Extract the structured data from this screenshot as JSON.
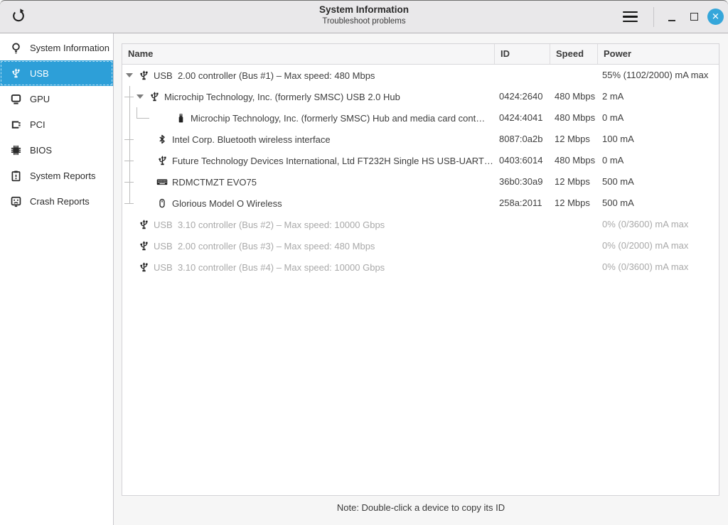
{
  "titlebar": {
    "title": "System Information",
    "subtitle": "Troubleshoot problems",
    "icons": [
      "refresh-icon",
      "menu-icon",
      "minimize-icon",
      "maximize-icon",
      "close-icon"
    ],
    "close_x": "✕"
  },
  "sidebar": {
    "items": [
      {
        "label": "System Information",
        "icon": "lightbulb-icon",
        "selected": false
      },
      {
        "label": "USB",
        "icon": "usb-icon",
        "selected": true
      },
      {
        "label": "GPU",
        "icon": "display-icon",
        "selected": false
      },
      {
        "label": "PCI",
        "icon": "pci-icon",
        "selected": false
      },
      {
        "label": "BIOS",
        "icon": "chip-icon",
        "selected": false
      },
      {
        "label": "System Reports",
        "icon": "report-icon",
        "selected": false
      },
      {
        "label": "Crash Reports",
        "icon": "crash-icon",
        "selected": false
      }
    ]
  },
  "table": {
    "columns": [
      "Name",
      "ID",
      "Speed",
      "Power"
    ],
    "rows": [
      {
        "name": "USB  2.00 controller (Bus #1) – Max speed: 480 Mbps",
        "id": "",
        "speed": "",
        "power": "55% (1102/2000) mA max",
        "icon": "usb-icon",
        "level": 0,
        "has_expander": true,
        "tree": "",
        "dim": false
      },
      {
        "name": "Microchip Technology, Inc. (formerly SMSC) USB 2.0 Hub",
        "id": "0424:2640",
        "speed": "480 Mbps",
        "power": "2 mA",
        "icon": "usb-icon",
        "level": 1,
        "has_expander": true,
        "tree": "mid",
        "dim": false
      },
      {
        "name": "Microchip Technology, Inc. (formerly SMSC) Hub and media card cont…",
        "id": "0424:4041",
        "speed": "480 Mbps",
        "power": "0 mA",
        "icon": "flash-drive-icon",
        "level": 2,
        "has_expander": false,
        "tree": "pass,end2",
        "dim": false
      },
      {
        "name": "Intel Corp. Bluetooth wireless interface",
        "id": "8087:0a2b",
        "speed": "12 Mbps",
        "power": "100 mA",
        "icon": "bluetooth-icon",
        "level": 1,
        "has_expander": false,
        "tree": "mid",
        "dim": false
      },
      {
        "name": "Future Technology Devices International, Ltd FT232H Single HS USB-UART…",
        "id": "0403:6014",
        "speed": "480 Mbps",
        "power": "0 mA",
        "icon": "usb-icon",
        "level": 1,
        "has_expander": false,
        "tree": "mid",
        "dim": false
      },
      {
        "name": "RDMCTMZT EVO75",
        "id": "36b0:30a9",
        "speed": "12 Mbps",
        "power": "500 mA",
        "icon": "keyboard-icon",
        "level": 1,
        "has_expander": false,
        "tree": "mid",
        "dim": false
      },
      {
        "name": "Glorious Model O Wireless",
        "id": "258a:2011",
        "speed": "12 Mbps",
        "power": "500 mA",
        "icon": "mouse-icon",
        "level": 1,
        "has_expander": false,
        "tree": "end",
        "dim": false
      },
      {
        "name": "USB  3.10 controller (Bus #2) – Max speed: 10000 Gbps",
        "id": "",
        "speed": "",
        "power": "0% (0/3600) mA max",
        "icon": "usb-icon",
        "level": 0,
        "has_expander": false,
        "tree": "",
        "dim": true
      },
      {
        "name": "USB  2.00 controller (Bus #3) – Max speed: 480 Mbps",
        "id": "",
        "speed": "",
        "power": "0% (0/2000) mA max",
        "icon": "usb-icon",
        "level": 0,
        "has_expander": false,
        "tree": "",
        "dim": true
      },
      {
        "name": "USB  3.10 controller (Bus #4) – Max speed: 10000 Gbps",
        "id": "",
        "speed": "",
        "power": "0% (0/3600) mA max",
        "icon": "usb-icon",
        "level": 0,
        "has_expander": false,
        "tree": "",
        "dim": true
      }
    ]
  },
  "footer": {
    "note": "Note: Double-click a device to copy its ID"
  },
  "colors": {
    "accent": "#2d9fd8",
    "close_button": "#35a6da",
    "dim_text": "#a9a9a9",
    "titlebar_bg": "#e9e8ea",
    "sidebar_bg": "#ffffff",
    "table_bg": "#ffffff"
  }
}
